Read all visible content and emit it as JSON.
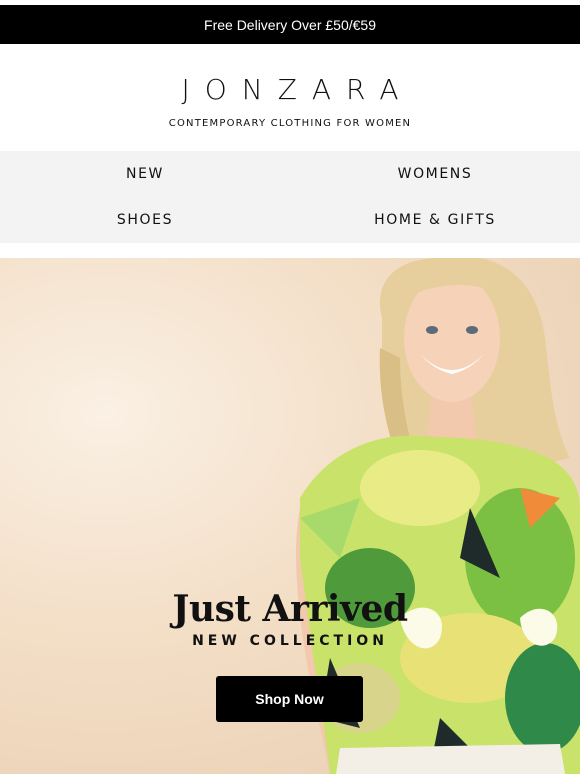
{
  "promo": {
    "text": "Free Delivery Over £50/€59"
  },
  "brand": {
    "logo": "JONZARA",
    "tagline": "CONTEMPORARY CLOTHING FOR WOMEN"
  },
  "nav": {
    "items": [
      "NEW",
      "WOMENS",
      "SHOES",
      "HOME & GIFTS"
    ]
  },
  "hero": {
    "title": "Just Arrived",
    "subtitle": "NEW COLLECTION",
    "cta": "Shop Now",
    "image": "woman-in-tropical-print-top"
  },
  "colors": {
    "promo_bg": "#000000",
    "nav_bg": "#f3f3f3",
    "hero_bg": "#f3dec6",
    "cta_bg": "#000000"
  }
}
